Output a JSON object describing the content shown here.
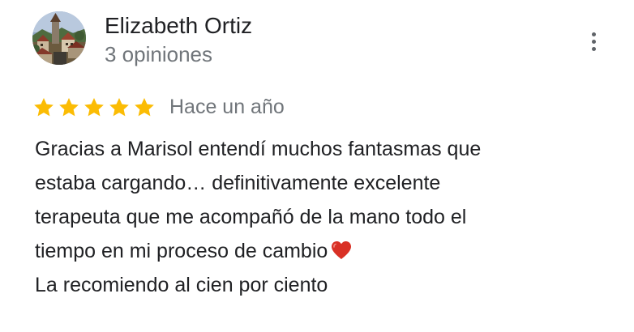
{
  "review": {
    "author": {
      "name": "Elizabeth Ortiz",
      "meta": "3 opiniones",
      "avatar_icon": "avatar-photo-town-icon"
    },
    "menu_icon": "more-vert-icon",
    "rating": {
      "value": 5,
      "max": 5,
      "star_color": "#FBBC04"
    },
    "date": "Hace un año",
    "text_lines": [
      "Gracias a Marisol entendí muchos fantasmas que",
      "estaba cargando… definitivamente excelente",
      "terapeuta que me acompañó de la mano todo el",
      "tiempo en mi proceso de cambio",
      "La recomiendo al cien por ciento"
    ],
    "emoji_icon": "red-heart-icon",
    "colors": {
      "primary_text": "#202124",
      "secondary_text": "#70757a",
      "heart": "#d93025"
    }
  }
}
